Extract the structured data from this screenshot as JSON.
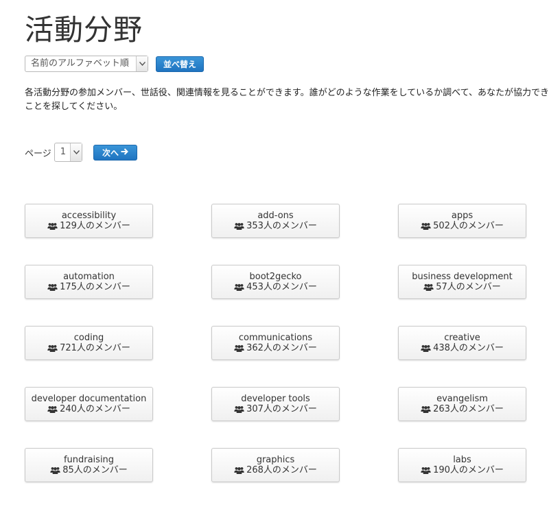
{
  "page": {
    "title": "活動分野",
    "description": "各活動分野の参加メンバー、世話役、関連情報を見ることができます。誰がどのような作業をしているか調べて、あなたが協力できることを探してください。"
  },
  "sort": {
    "selected": "名前のアルファベット順",
    "button_label": "並べ替え"
  },
  "pager": {
    "label": "ページ",
    "current": "1",
    "next_label": "次へ"
  },
  "members_suffix": "人のメンバー",
  "colors": {
    "accent": "#2a84cc",
    "card_border": "#c9c9c9",
    "text": "#333333"
  },
  "icons": {
    "member_count": "users-icon",
    "next": "arrow-right-icon",
    "select": "chevron-down-icon"
  },
  "groups": [
    {
      "name": "accessibility",
      "count": "129"
    },
    {
      "name": "add-ons",
      "count": "353"
    },
    {
      "name": "apps",
      "count": "502"
    },
    {
      "name": "automation",
      "count": "175"
    },
    {
      "name": "boot2gecko",
      "count": "453"
    },
    {
      "name": "business development",
      "count": "57"
    },
    {
      "name": "coding",
      "count": "721"
    },
    {
      "name": "communications",
      "count": "362"
    },
    {
      "name": "creative",
      "count": "438"
    },
    {
      "name": "developer documentation",
      "count": "240"
    },
    {
      "name": "developer tools",
      "count": "307"
    },
    {
      "name": "evangelism",
      "count": "263"
    },
    {
      "name": "fundraising",
      "count": "85"
    },
    {
      "name": "graphics",
      "count": "268"
    },
    {
      "name": "labs",
      "count": "190"
    }
  ]
}
